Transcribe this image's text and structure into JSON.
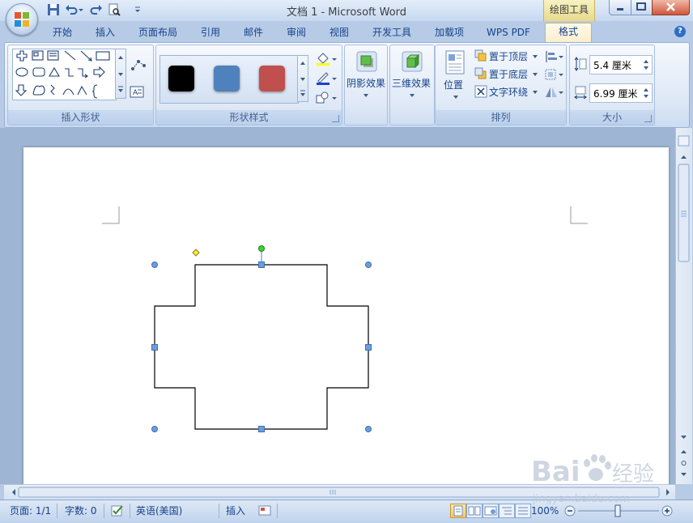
{
  "window": {
    "title": "文档 1 - Microsoft Word",
    "context_tab": "绘图工具"
  },
  "tabs": [
    {
      "label": "开始",
      "active": false
    },
    {
      "label": "插入",
      "active": false
    },
    {
      "label": "页面布局",
      "active": false
    },
    {
      "label": "引用",
      "active": false
    },
    {
      "label": "邮件",
      "active": false
    },
    {
      "label": "审阅",
      "active": false
    },
    {
      "label": "视图",
      "active": false
    },
    {
      "label": "开发工具",
      "active": false
    },
    {
      "label": "加载项",
      "active": false
    },
    {
      "label": "WPS PDF",
      "active": false
    },
    {
      "label": "格式",
      "active": true
    }
  ],
  "ribbon": {
    "insert_shapes": {
      "label": "插入形状"
    },
    "shape_styles": {
      "label": "形状样式",
      "swatches": [
        "#000000",
        "#4f81bd",
        "#c0504d"
      ]
    },
    "shadow": {
      "label": "阴影效果"
    },
    "threed": {
      "label": "三维效果"
    },
    "arrange": {
      "label": "排列",
      "position": "位置",
      "bring_front": "置于顶层",
      "send_back": "置于底层",
      "text_wrap": "文字环绕"
    },
    "size": {
      "label": "大小",
      "height": "5.4 厘米",
      "width": "6.99 厘米"
    }
  },
  "statusbar": {
    "page": "页面: 1/1",
    "words": "字数: 0",
    "language": "英语(美国)",
    "insert_mode": "插入",
    "zoom": "100%"
  },
  "watermark": {
    "brand": "Bai",
    "brand_cn": "经验",
    "url": "jingyan.baidu.com"
  },
  "colors": {
    "accent": "#15428b",
    "ribbon_bg": "#dfe9f6",
    "active_tab": "#fbeecf"
  }
}
